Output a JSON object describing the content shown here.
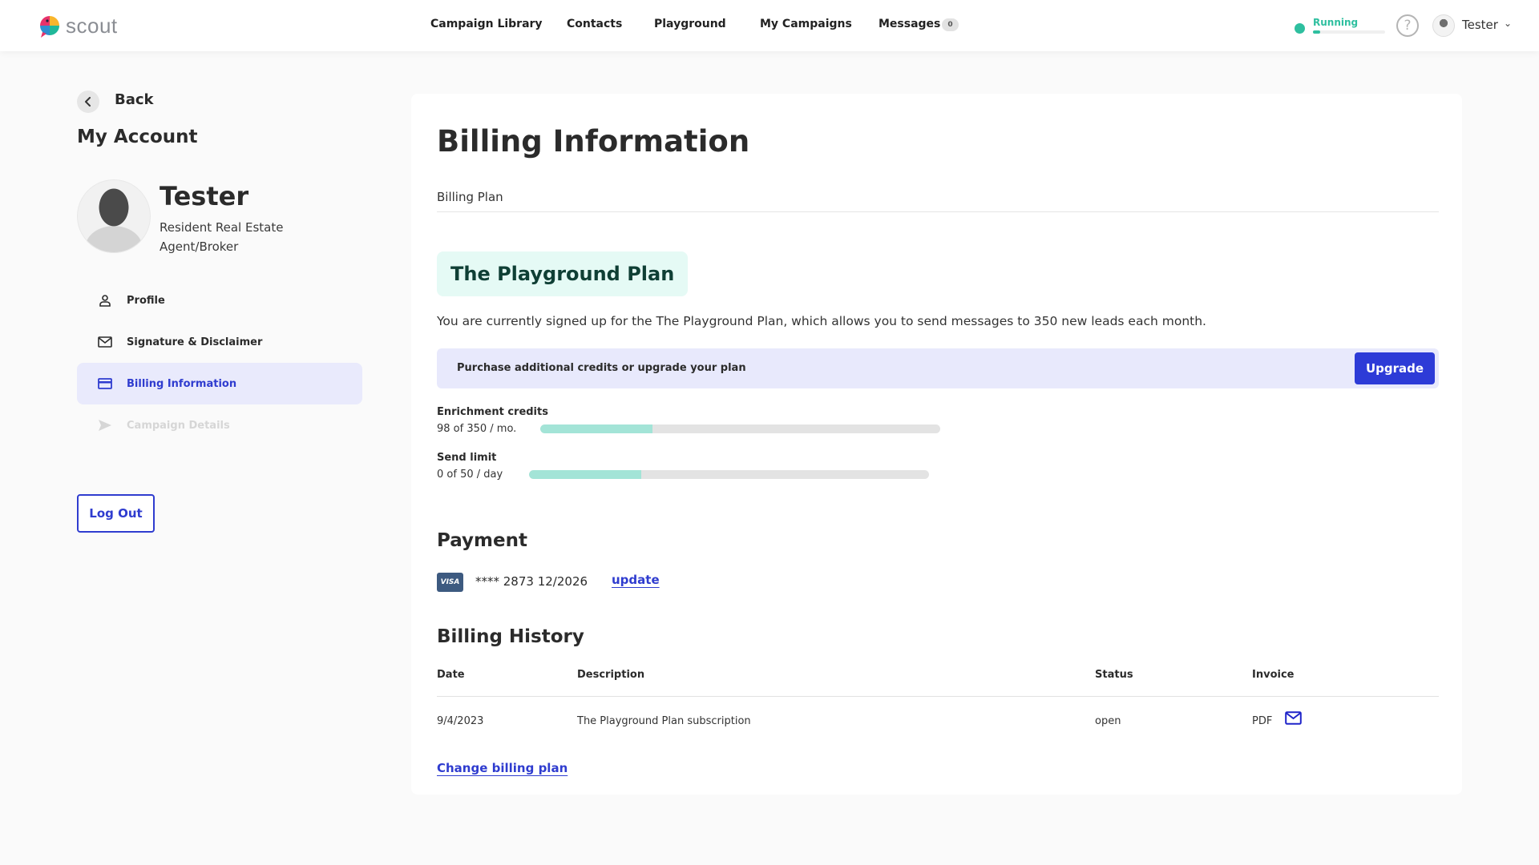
{
  "header": {
    "brand": "scout",
    "nav": [
      {
        "label": "Campaign Library"
      },
      {
        "label": "Contacts"
      },
      {
        "label": "Playground"
      },
      {
        "label": "My Campaigns"
      },
      {
        "label": "Messages",
        "badge": "0"
      }
    ],
    "status": {
      "label": "Running",
      "progress_fraction": 0.1,
      "color": "#2ebf9f"
    },
    "help_glyph": "?",
    "user": {
      "name": "Tester",
      "chevron_glyph": "⌄"
    }
  },
  "sidebar": {
    "back_label": "Back",
    "title": "My Account",
    "profile": {
      "name": "Tester",
      "role": "Resident Real Estate Agent/Broker"
    },
    "items": [
      {
        "label": "Profile",
        "icon": "user-icon",
        "state": "normal"
      },
      {
        "label": "Signature & Disclaimer",
        "icon": "mail-icon",
        "state": "normal"
      },
      {
        "label": "Billing Information",
        "icon": "credit-card-icon",
        "state": "active"
      },
      {
        "label": "Campaign Details",
        "icon": "send-icon",
        "state": "disabled"
      }
    ],
    "logout_label": "Log Out"
  },
  "main": {
    "title": "Billing Information",
    "section_tab": "Billing Plan",
    "plan_name": "The Playground Plan",
    "plan_description": "You are currently signed up for the The Playground Plan, which allows you to send messages to 350 new leads each month.",
    "upgrade_prompt": "Purchase additional credits or upgrade your plan",
    "upgrade_button": "Upgrade",
    "meters": [
      {
        "label": "Enrichment credits",
        "value_text": "98 of 350 / mo.",
        "used": 98,
        "total": 350,
        "fill_fraction": 0.28
      },
      {
        "label": "Send limit",
        "value_text": "0 of 50 / day",
        "used": 0,
        "total": 50,
        "fill_fraction": 0.28
      }
    ],
    "payment": {
      "heading": "Payment",
      "card_brand": "VISA",
      "card_text": "**** 2873 12/2026",
      "update_label": "update"
    },
    "billing_history": {
      "heading": "Billing History",
      "columns": [
        "Date",
        "Description",
        "Status",
        "Invoice"
      ],
      "rows": [
        {
          "date": "9/4/2023",
          "description": "The Playground Plan subscription",
          "status": "open",
          "invoice": "PDF",
          "invoice_icon": "mail-icon"
        }
      ]
    },
    "change_plan_label": "Change billing plan"
  },
  "colors": {
    "accent": "#2f3ccf",
    "accent_button": "#2d3bd7",
    "active_bg": "#e9eafc",
    "plan_chip_bg": "#e5faf5",
    "meter_fill": "#a3e4d7",
    "running": "#2ebf9f"
  }
}
